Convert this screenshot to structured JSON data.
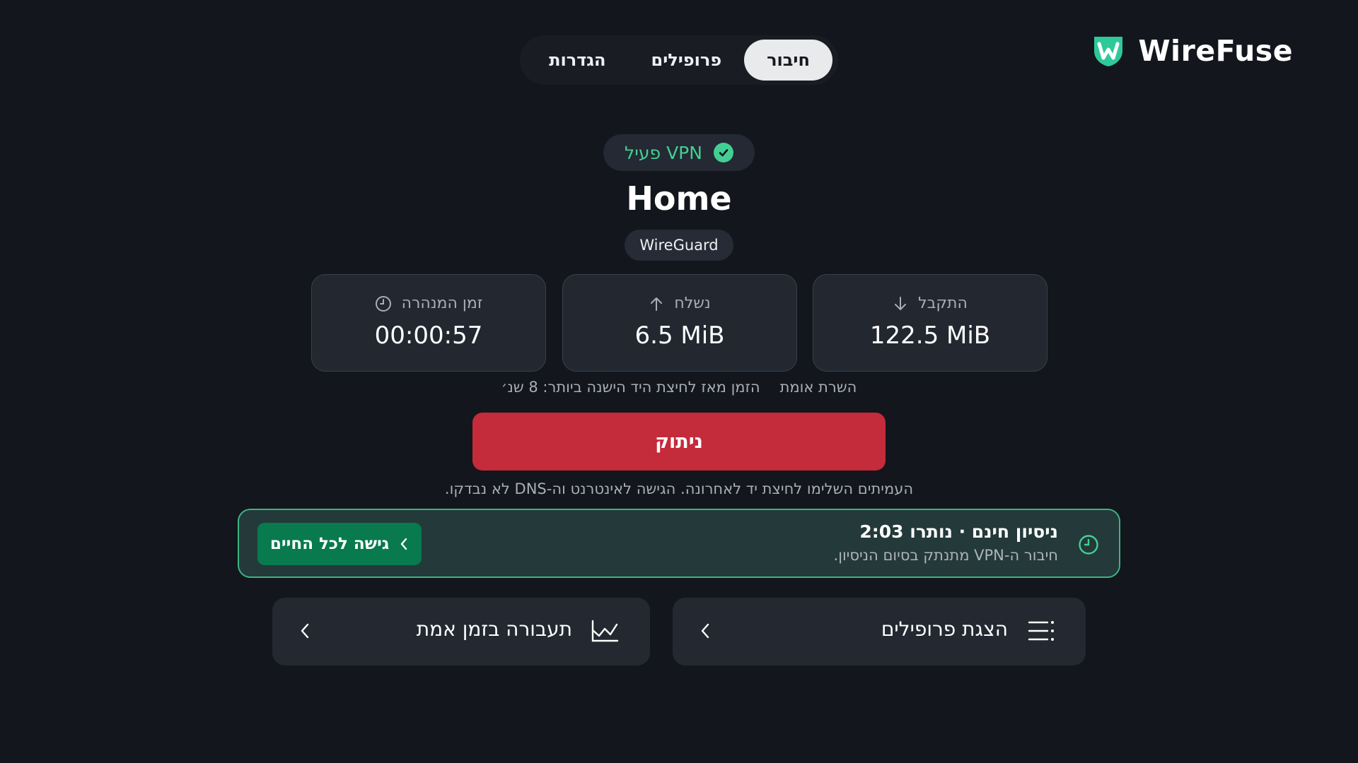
{
  "app": {
    "name": "WireFuse"
  },
  "nav": {
    "tabs": [
      {
        "label": "חיבור",
        "active": true
      },
      {
        "label": "פרופילים",
        "active": false
      },
      {
        "label": "הגדרות",
        "active": false
      }
    ]
  },
  "status": {
    "text": "VPN פעיל",
    "color": "#43cf93",
    "icon": "check-circle-icon"
  },
  "profile": {
    "name": "Home",
    "protocol": "WireGuard"
  },
  "stats": {
    "received": {
      "label": "התקבל",
      "value": "122.5 MiB",
      "icon": "arrow-down-icon"
    },
    "sent": {
      "label": "נשלח",
      "value": "6.5 MiB",
      "icon": "arrow-up-icon"
    },
    "tunnel_time": {
      "label": "זמן המנהרה",
      "value": "00:00:57",
      "icon": "clock-icon"
    }
  },
  "meta": {
    "server_verified": "השרת אומת",
    "handshake": "הזמן מאז לחיצת היד הישנה ביותר: 8 שנ׳"
  },
  "disconnect": {
    "label": "ניתוק",
    "color": "#c42b3b"
  },
  "note": "העמיתים השלימו לחיצת יד לאחרונה. הגישה לאינטרנט וה-DNS לא נבדקו.",
  "trial": {
    "title": "ניסיון חינם · נותרו 2:03",
    "subtitle": "חיבור ה-VPN מתנתק בסיום הניסיון.",
    "button_label": "גישה לכל החיים",
    "accent": "#3bb583"
  },
  "actions": {
    "profiles": {
      "label": "הצגת פרופילים",
      "icon": "list-icon"
    },
    "traffic": {
      "label": "תעבורה בזמן אמת",
      "icon": "chart-icon"
    }
  }
}
